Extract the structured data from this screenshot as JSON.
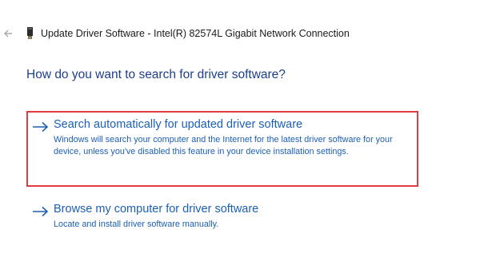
{
  "window": {
    "title": "Update Driver Software - Intel(R) 82574L Gigabit Network Connection",
    "back_icon": "back-arrow-icon",
    "device_icon": "network-adapter-icon"
  },
  "heading": "How do you want to search for driver software?",
  "options": [
    {
      "title": "Search automatically for updated driver software",
      "description": "Windows will search your computer and the Internet for the latest driver software for your device, unless you've disabled this feature in your device installation settings.",
      "icon": "right-arrow-icon",
      "highlighted": true
    },
    {
      "title": "Browse my computer for driver software",
      "description": "Locate and install driver software manually.",
      "icon": "right-arrow-icon",
      "highlighted": false
    }
  ],
  "colors": {
    "heading": "#1c3f8c",
    "link": "#1c5fb4",
    "highlight_border": "#e23b3b"
  }
}
